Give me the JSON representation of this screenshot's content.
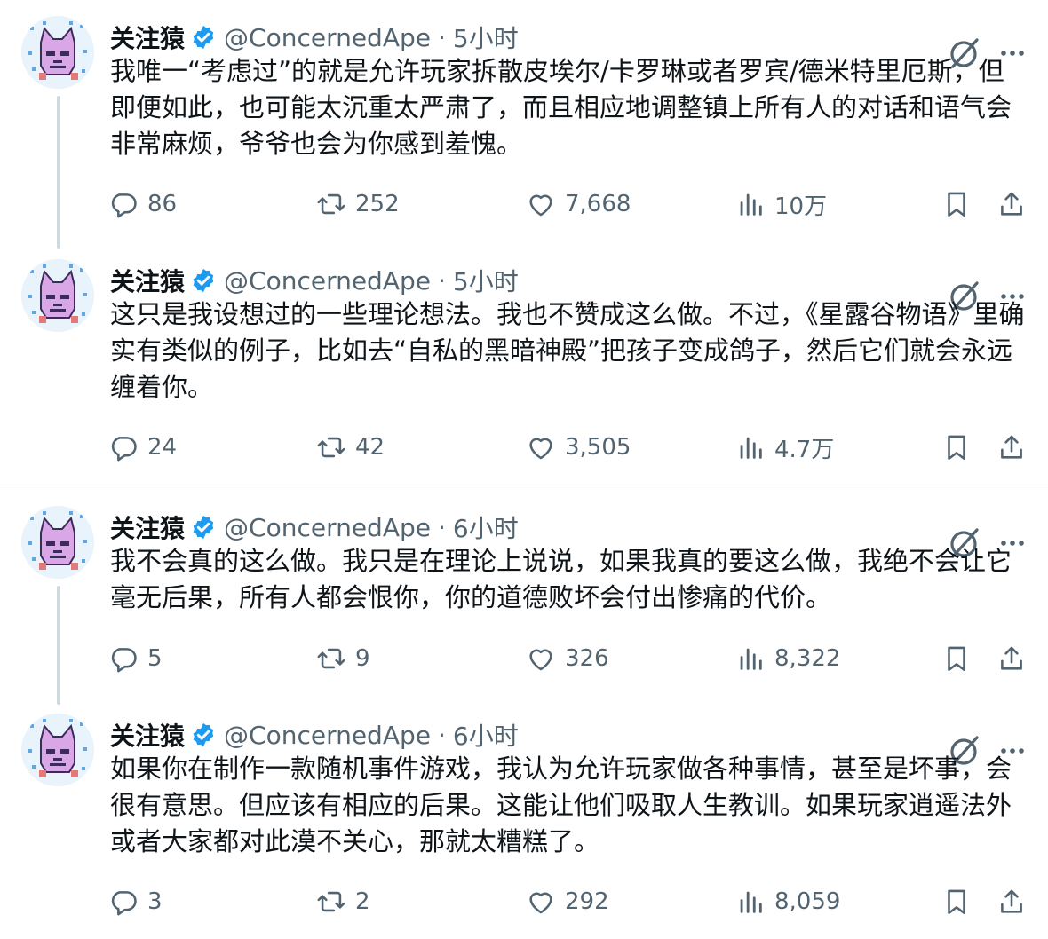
{
  "tweets": [
    {
      "display_name": "关注猿",
      "handle": "@ConcernedApe",
      "separator": "·",
      "time": "5小时",
      "text": "我唯一“考虑过”的就是允许玩家拆散皮埃尔/卡罗琳或者罗宾/德米特里厄斯，但即便如此，也可能太沉重太严肃了，而且相应地调整镇上所有人的对话和语气会非常麻烦，爷爷也会为你感到羞愧。",
      "replies": "86",
      "retweets": "252",
      "likes": "7,668",
      "views": "10万"
    },
    {
      "display_name": "关注猿",
      "handle": "@ConcernedApe",
      "separator": "·",
      "time": "5小时",
      "text": "这只是我设想过的一些理论想法。我也不赞成这么做。不过，《星露谷物语》里确实有类似的例子，比如去“自私的黑暗神殿”把孩子变成鸽子，然后它们就会永远缠着你。",
      "replies": "24",
      "retweets": "42",
      "likes": "3,505",
      "views": "4.7万"
    },
    {
      "display_name": "关注猿",
      "handle": "@ConcernedApe",
      "separator": "·",
      "time": "6小时",
      "text": "我不会真的这么做。我只是在理论上说说，如果我真的要这么做，我绝不会让它毫无后果，所有人都会恨你，你的道德败坏会付出惨痛的代价。",
      "replies": "5",
      "retweets": "9",
      "likes": "326",
      "views": "8,322"
    },
    {
      "display_name": "关注猿",
      "handle": "@ConcernedApe",
      "separator": "·",
      "time": "6小时",
      "text": "如果你在制作一款随机事件游戏，我认为允许玩家做各种事情，甚至是坏事，会很有意思。但应该有相应的后果。这能让他们吸取人生教训。如果玩家逍遥法外或者大家都对此漠不关心，那就太糟糕了。",
      "replies": "3",
      "retweets": "2",
      "likes": "292",
      "views": "8,059"
    }
  ],
  "icons": {
    "avatar": "pixel-cat-avatar",
    "verified": "verified-badge-icon",
    "grok": "grok-icon",
    "more": "more-icon",
    "reply": "reply-icon",
    "retweet": "retweet-icon",
    "like": "like-icon",
    "views": "views-icon",
    "bookmark": "bookmark-icon",
    "share": "share-icon"
  },
  "colors": {
    "text": "#0f1419",
    "secondary": "#536471",
    "verified": "#1d9bf0",
    "thread_line": "#cfd9de",
    "divider": "#eff3f4"
  }
}
